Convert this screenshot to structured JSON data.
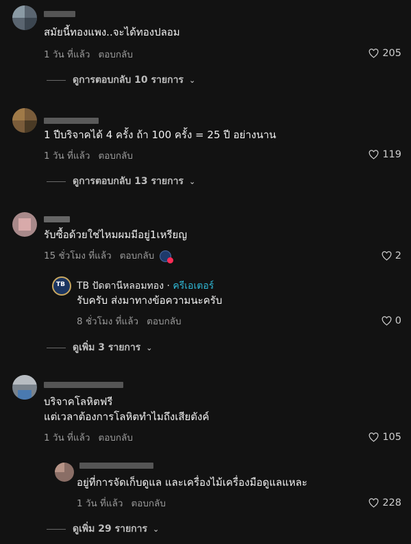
{
  "comments": [
    {
      "text": "สมัยนี้ทองแพง..จะได้ทองปลอม",
      "time": "1 วัน ที่แล้ว",
      "reply": "ตอบกลับ",
      "likes": "205",
      "view_replies": "ดูการตอบกลับ 10 รายการ"
    },
    {
      "text": "1 ปีบริจาคได้ 4 ครั้ง ถ้า 100 ครั้ง = 25 ปี อย่างนาน",
      "time": "1 วัน ที่แล้ว",
      "reply": "ตอบกลับ",
      "likes": "119",
      "view_replies": "ดูการตอบกลับ 13 รายการ"
    },
    {
      "text": "รับซื้อด้วยใช่ไหมผมมีอยู่1เหรียญ",
      "time": "15 ชั่วโมง ที่แล้ว",
      "reply": "ตอบกลับ",
      "likes": "2",
      "creator_reply": {
        "avatar_text": "TB",
        "name": "TB ปัดตานีหลอมทอง",
        "separator": " · ",
        "tag": "ครีเอเตอร์",
        "text": "รับครับ ส่งมาทางข้อความนะครับ",
        "time": "8 ชั่วโมง ที่แล้ว",
        "reply": "ตอบกลับ",
        "likes": "0"
      },
      "view_more": "ดูเพิ่ม 3 รายการ"
    },
    {
      "text_line1": "บริจาคโลหิตฟรี",
      "text_line2": "แต่เวลาต้องการโลหิตทำไมถึงเสียตังค์",
      "time": "1 วัน ที่แล้ว",
      "reply": "ตอบกลับ",
      "likes": "105",
      "sub_reply": {
        "text": "อยู่ที่การจัดเก็บดูแล และเครื่องไม้เครื่องมือดูแลแหละ",
        "time": "1 วัน ที่แล้ว",
        "reply": "ตอบกลับ",
        "likes": "228"
      },
      "view_more": "ดูเพิ่ม 29 รายการ"
    }
  ],
  "icons": {
    "like": "heart-outline-icon",
    "expand": "chevron-down-icon"
  }
}
